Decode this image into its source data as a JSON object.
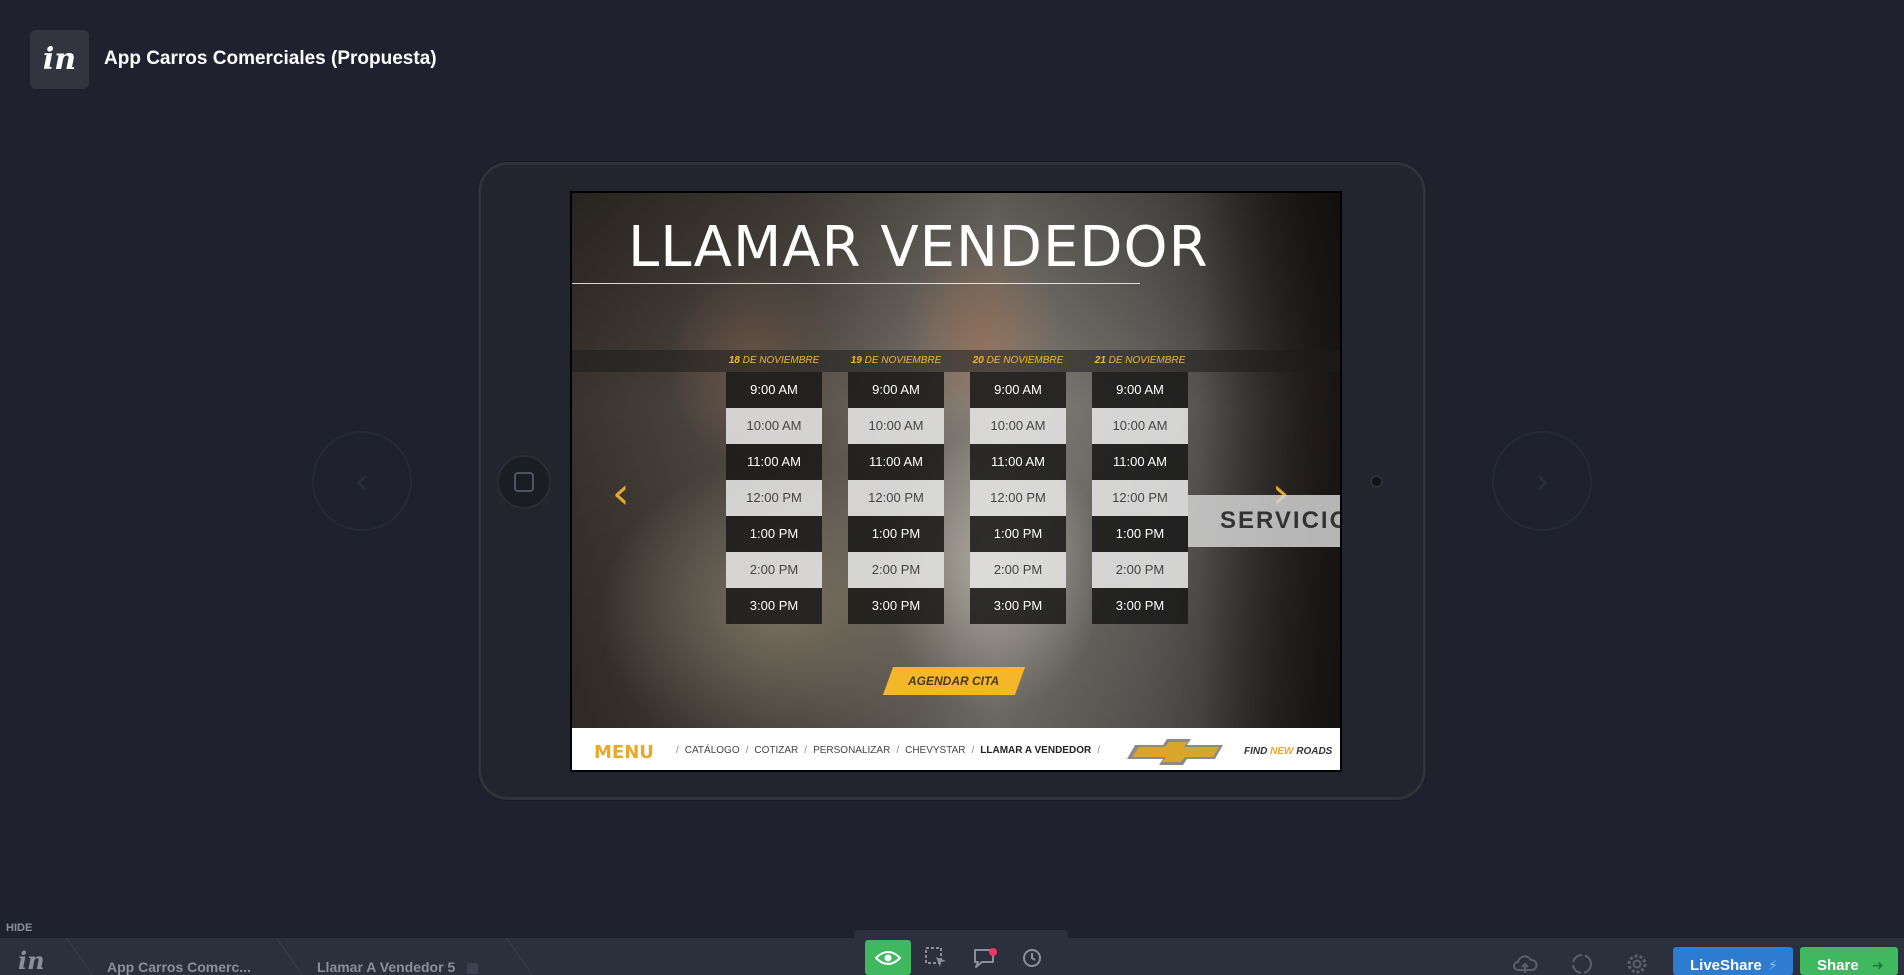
{
  "header": {
    "logo_text": "in",
    "project_title": "App Carros Comerciales (Propuesta)"
  },
  "nav": {
    "prev_icon": "chevron-left-icon",
    "next_icon": "chevron-right-icon",
    "prev_glyph": "‹",
    "next_glyph": "›"
  },
  "screen": {
    "title": "LLAMAR VENDEDOR",
    "columns": [
      {
        "day": "18",
        "month": " DE NOVIEMBRE",
        "slots": [
          "9:00 AM",
          "10:00 AM",
          "11:00 AM",
          "12:00 PM",
          "1:00 PM",
          "2:00 PM",
          "3:00 PM"
        ]
      },
      {
        "day": "19",
        "month": " DE NOVIEMBRE",
        "slots": [
          "9:00 AM",
          "10:00 AM",
          "11:00 AM",
          "12:00 PM",
          "1:00 PM",
          "2:00 PM",
          "3:00 PM"
        ]
      },
      {
        "day": "20",
        "month": " DE NOVIEMBRE",
        "slots": [
          "9:00 AM",
          "10:00 AM",
          "11:00 AM",
          "12:00 PM",
          "1:00 PM",
          "2:00 PM",
          "3:00 PM"
        ]
      },
      {
        "day": "21",
        "month": " DE NOVIEMBRE",
        "slots": [
          "9:00 AM",
          "10:00 AM",
          "11:00 AM",
          "12:00 PM",
          "1:00 PM",
          "2:00 PM",
          "3:00 PM"
        ]
      }
    ],
    "arrow_left": "‹",
    "arrow_right": "›",
    "servicio_label": "SERVICIO",
    "agendar_label": "AGENDAR CITA",
    "footer": {
      "menu_label": "MENU",
      "nav_items": [
        "CATÁLOGO",
        "COTIZAR",
        "PERSONALIZAR",
        "CHEVYSTAR",
        "LLAMAR A VENDEDOR"
      ],
      "active_item": "LLAMAR A VENDEDOR",
      "tagline_find": "FIND ",
      "tagline_new": "NEW",
      "tagline_roads": " ROADS",
      "tagline_tm": "*"
    }
  },
  "bottom_bar": {
    "hide_label": "HIDE",
    "logo_text": "in",
    "crumb_project": "App Carros Comerc...",
    "crumb_screen": "Llamar A Vendedor 5",
    "liveshare_label": "LiveShare",
    "share_label": "Share",
    "toolbar_icons": [
      "eye-icon",
      "select-cursor-icon",
      "comment-icon",
      "history-icon"
    ],
    "right_icons": [
      "cloud-upload-icon",
      "sync-icon",
      "gear-icon"
    ]
  },
  "colors": {
    "background": "#1f222e",
    "accent_yellow": "#f4b72a",
    "liveshare_blue": "#2d7cd1",
    "share_green": "#3fb860"
  }
}
